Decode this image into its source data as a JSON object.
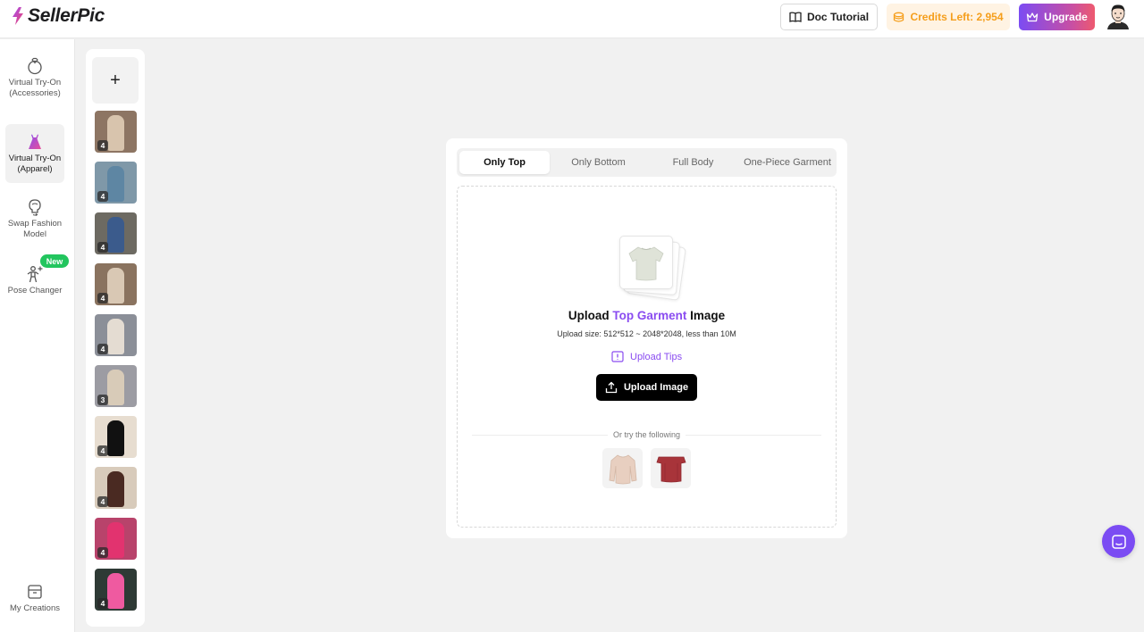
{
  "header": {
    "brand": "SellerPic",
    "doc_tutorial": "Doc Tutorial",
    "credits": "Credits Left: 2,954",
    "upgrade": "Upgrade"
  },
  "nav": {
    "items": [
      {
        "label": "Virtual Try-On (Accessories)",
        "icon": "ring-icon"
      },
      {
        "label": "Virtual Try-On (Apparel)",
        "icon": "dress-icon",
        "active": true
      },
      {
        "label": "Swap Fashion Model",
        "icon": "face-swap-icon"
      },
      {
        "label": "Pose Changer",
        "icon": "pose-icon",
        "badge": "New"
      }
    ],
    "my_creations": "My Creations"
  },
  "history": {
    "add_label": "+",
    "items": [
      {
        "count": "4",
        "bg": "#8d7563",
        "fig": "#d8c4ad"
      },
      {
        "count": "4",
        "bg": "#7f98a8",
        "fig": "#5e86a3"
      },
      {
        "count": "4",
        "bg": "#6d6a62",
        "fig": "#3b5b8c"
      },
      {
        "count": "4",
        "bg": "#8a735f",
        "fig": "#d9c8b4"
      },
      {
        "count": "4",
        "bg": "#8b8f98",
        "fig": "#e4dcd2"
      },
      {
        "count": "3",
        "bg": "#9c9ca3",
        "fig": "#d8cbb8"
      },
      {
        "count": "4",
        "bg": "#e7ddd0",
        "fig": "#111111"
      },
      {
        "count": "4",
        "bg": "#d8cbbb",
        "fig": "#4a2a22"
      },
      {
        "count": "4",
        "bg": "#b8436b",
        "fig": "#e2336f"
      },
      {
        "count": "4",
        "bg": "#2e3a35",
        "fig": "#ef5aa0"
      }
    ]
  },
  "main": {
    "tabs": [
      "Only Top",
      "Only Bottom",
      "Full Body",
      "One-Piece Garment"
    ],
    "active_tab": "Only Top",
    "title_prefix": "Upload ",
    "title_highlight": "Top Garment",
    "title_suffix": " Image",
    "size_note": "Upload size: 512*512 ~ 2048*2048, less than 10M",
    "tips": "Upload Tips",
    "upload_button": "Upload Image",
    "or_try": "Or try the following",
    "samples": [
      "beige-sweater",
      "red-off-shoulder-top"
    ]
  },
  "colors": {
    "accent": "#8a4cf0",
    "credits": "#f59e1b",
    "new_badge": "#22c55e"
  }
}
